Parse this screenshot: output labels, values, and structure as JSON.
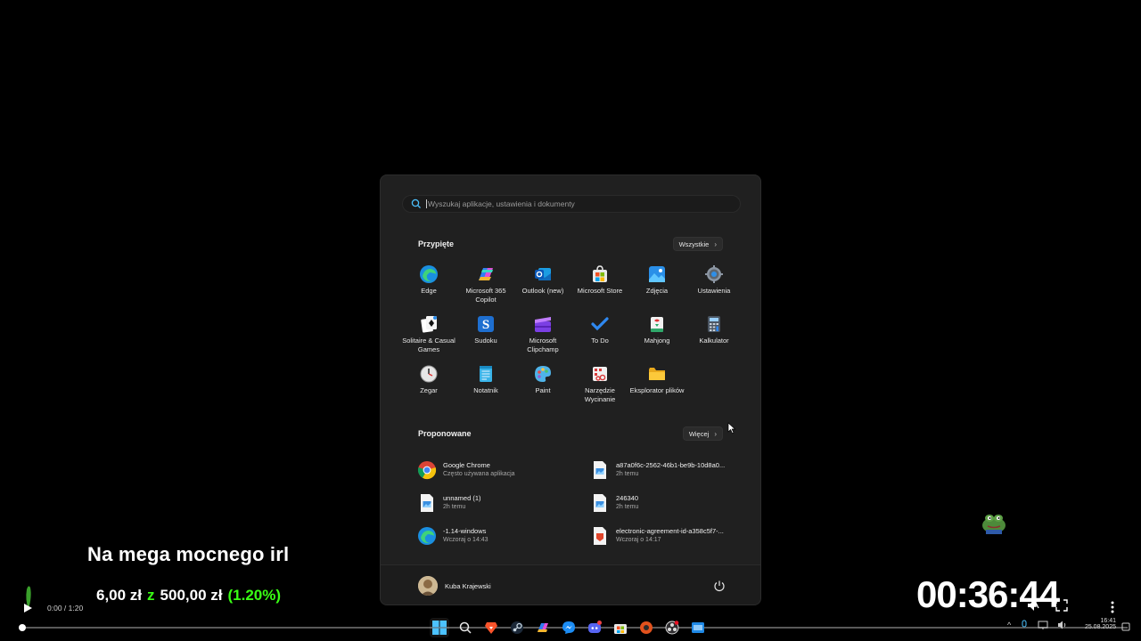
{
  "start_menu": {
    "search": {
      "placeholder": "Wyszukaj aplikacje, ustawienia i dokumenty"
    },
    "pinned": {
      "title": "Przypięte",
      "all_button": "Wszystkie",
      "apps": [
        {
          "label": "Edge",
          "icon": "edge-icon"
        },
        {
          "label": "Microsoft 365 Copilot",
          "icon": "copilot-icon"
        },
        {
          "label": "Outlook (new)",
          "icon": "outlook-icon"
        },
        {
          "label": "Microsoft Store",
          "icon": "store-icon"
        },
        {
          "label": "Zdjęcia",
          "icon": "photos-icon"
        },
        {
          "label": "Ustawienia",
          "icon": "settings-gear-icon"
        },
        {
          "label": "Solitaire & Casual Games",
          "icon": "solitaire-icon"
        },
        {
          "label": "Sudoku",
          "icon": "sudoku-icon"
        },
        {
          "label": "Microsoft Clipchamp",
          "icon": "clipchamp-icon"
        },
        {
          "label": "To Do",
          "icon": "todo-check-icon"
        },
        {
          "label": "Mahjong",
          "icon": "mahjong-icon"
        },
        {
          "label": "Kalkulator",
          "icon": "calculator-icon"
        },
        {
          "label": "Zegar",
          "icon": "clock-icon"
        },
        {
          "label": "Notatnik",
          "icon": "notepad-icon"
        },
        {
          "label": "Paint",
          "icon": "paint-palette-icon"
        },
        {
          "label": "Narzędzie Wycinanie",
          "icon": "snipping-tool-icon"
        },
        {
          "label": "Eksplorator plików",
          "icon": "folder-icon"
        }
      ]
    },
    "recommended": {
      "title": "Proponowane",
      "more_button": "Więcej",
      "items": [
        {
          "title": "Google Chrome",
          "subtitle": "Często używana aplikacja",
          "icon": "chrome-icon"
        },
        {
          "title": "a87a0f6c-2562-46b1-be9b-10d8a0...",
          "subtitle": "2h temu",
          "icon": "image-file-icon"
        },
        {
          "title": "unnamed (1)",
          "subtitle": "2h temu",
          "icon": "image-file-icon"
        },
        {
          "title": "246340",
          "subtitle": "2h temu",
          "icon": "image-file-icon"
        },
        {
          "title": "-1.14-windows",
          "subtitle": "Wczoraj o 14:43",
          "icon": "edge-icon"
        },
        {
          "title": "electronic-agreement-id-a358c5f7-...",
          "subtitle": "Wczoraj o 14:17",
          "icon": "pdf-file-icon"
        }
      ]
    },
    "user": {
      "name": "Kuba Krajewski"
    }
  },
  "overlay": {
    "stream_title": "Na mega mocnego irl",
    "goal_current": "6,00 zł",
    "goal_sep": "z",
    "goal_target": "500,00 zł",
    "goal_pct": "(1.20%)",
    "timer": "00:36:44"
  },
  "player": {
    "time": "0:00 / 1:20",
    "progress_fraction": 0.0
  },
  "taskbar": {
    "icons": [
      "windows-start-icon",
      "search-icon",
      "brave-icon",
      "steam-icon",
      "copilot-icon",
      "messenger-icon",
      "discord-icon",
      "store-icon",
      "browser-icon",
      "obs-icon",
      "app-icon"
    ],
    "time": "16:41",
    "date": "25.08.2025"
  },
  "colors": {
    "menu_bg": "#202020",
    "accent_green": "#39ff14"
  }
}
